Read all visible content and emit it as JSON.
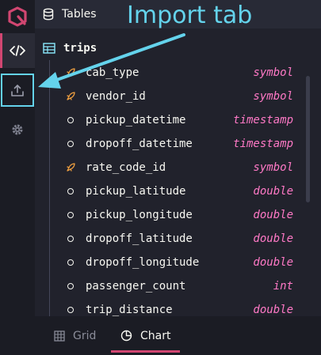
{
  "app": {
    "name": "QuestDB",
    "accent": "#d14671"
  },
  "sidebar": {
    "items": [
      {
        "id": "code",
        "icon": "code-icon",
        "active": true
      },
      {
        "id": "import",
        "icon": "upload-icon",
        "highlighted": true
      },
      {
        "id": "settings",
        "icon": "gear-icon"
      }
    ]
  },
  "panel": {
    "title": "Tables",
    "table": {
      "name": "trips",
      "columns": [
        {
          "name": "cab_type",
          "type": "symbol",
          "icon": "symbol-icon"
        },
        {
          "name": "vendor_id",
          "type": "symbol",
          "icon": "symbol-icon"
        },
        {
          "name": "pickup_datetime",
          "type": "timestamp",
          "icon": "circle-icon"
        },
        {
          "name": "dropoff_datetime",
          "type": "timestamp",
          "icon": "circle-icon"
        },
        {
          "name": "rate_code_id",
          "type": "symbol",
          "icon": "symbol-icon"
        },
        {
          "name": "pickup_latitude",
          "type": "double",
          "icon": "circle-icon"
        },
        {
          "name": "pickup_longitude",
          "type": "double",
          "icon": "circle-icon"
        },
        {
          "name": "dropoff_latitude",
          "type": "double",
          "icon": "circle-icon"
        },
        {
          "name": "dropoff_longitude",
          "type": "double",
          "icon": "circle-icon"
        },
        {
          "name": "passenger_count",
          "type": "int",
          "icon": "circle-icon"
        },
        {
          "name": "trip_distance",
          "type": "double",
          "icon": "circle-icon"
        }
      ]
    }
  },
  "bottom_tabs": [
    {
      "label": "Grid",
      "icon": "grid-icon",
      "active": false
    },
    {
      "label": "Chart",
      "icon": "chart-pie-icon",
      "active": true
    }
  ],
  "annotation": {
    "text": "Import tab",
    "color": "#64d3ec"
  }
}
